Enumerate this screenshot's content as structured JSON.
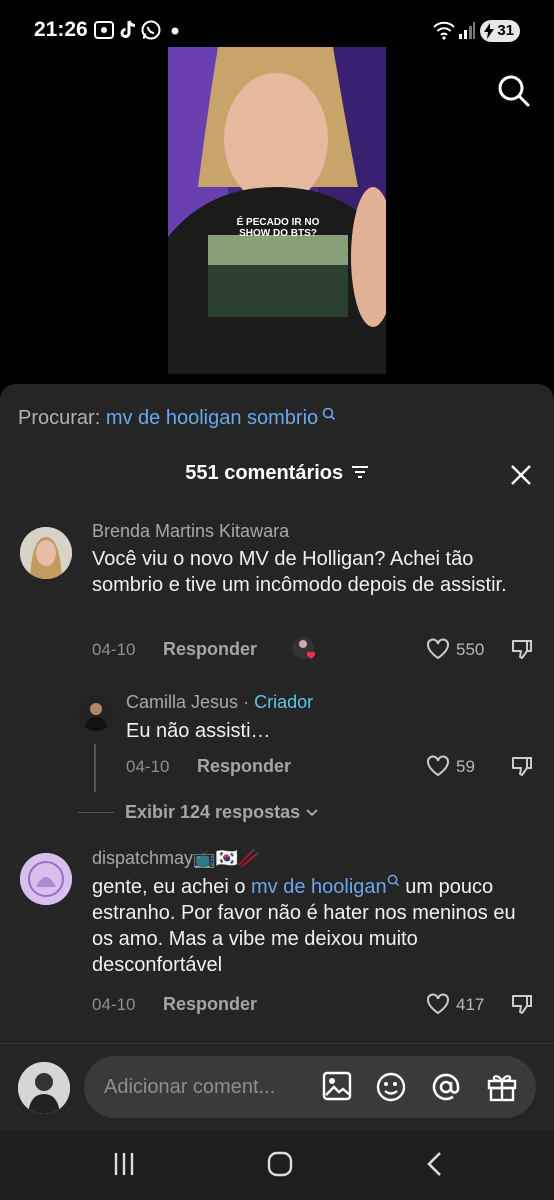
{
  "status_bar": {
    "time": "21:26",
    "battery": "31"
  },
  "search": {
    "prefix": "Procurar:",
    "query": "mv de hooligan sombrio"
  },
  "comments_header": {
    "title": "551 comentários"
  },
  "comments": [
    {
      "author": "Brenda Martins Kitawara",
      "text": "Você viu o novo MV de Holligan? Achei tão sombrio e tive um incômodo depois de assistir.",
      "date": "04-10",
      "reply_label": "Responder",
      "likes": "550"
    },
    {
      "author": "dispatchmay📺🇰🇷🥢",
      "text_before": "gente, eu achei o ",
      "link": "mv de hooligan",
      "text_after": " um pouco estranho. Por favor não é hater nos meninos eu os amo. Mas a vibe me deixou muito desconfortável",
      "date": "04-10",
      "reply_label": "Responder",
      "likes": "417"
    }
  ],
  "reply": {
    "author": "Camilla Jesus",
    "separator": "·",
    "badge": "Criador",
    "text": "Eu não assisti…",
    "date": "04-10",
    "reply_label": "Responder",
    "likes": "59"
  },
  "show_replies": "Exibir 124 respostas",
  "composer": {
    "placeholder": "Adicionar coment..."
  },
  "video": {
    "shirt_text": "É PECADO IR NO SHOW DO BTS?"
  },
  "colors": {
    "accent": "#6aa7ee",
    "creator": "#5ac7e8",
    "sheet": "#252525"
  }
}
